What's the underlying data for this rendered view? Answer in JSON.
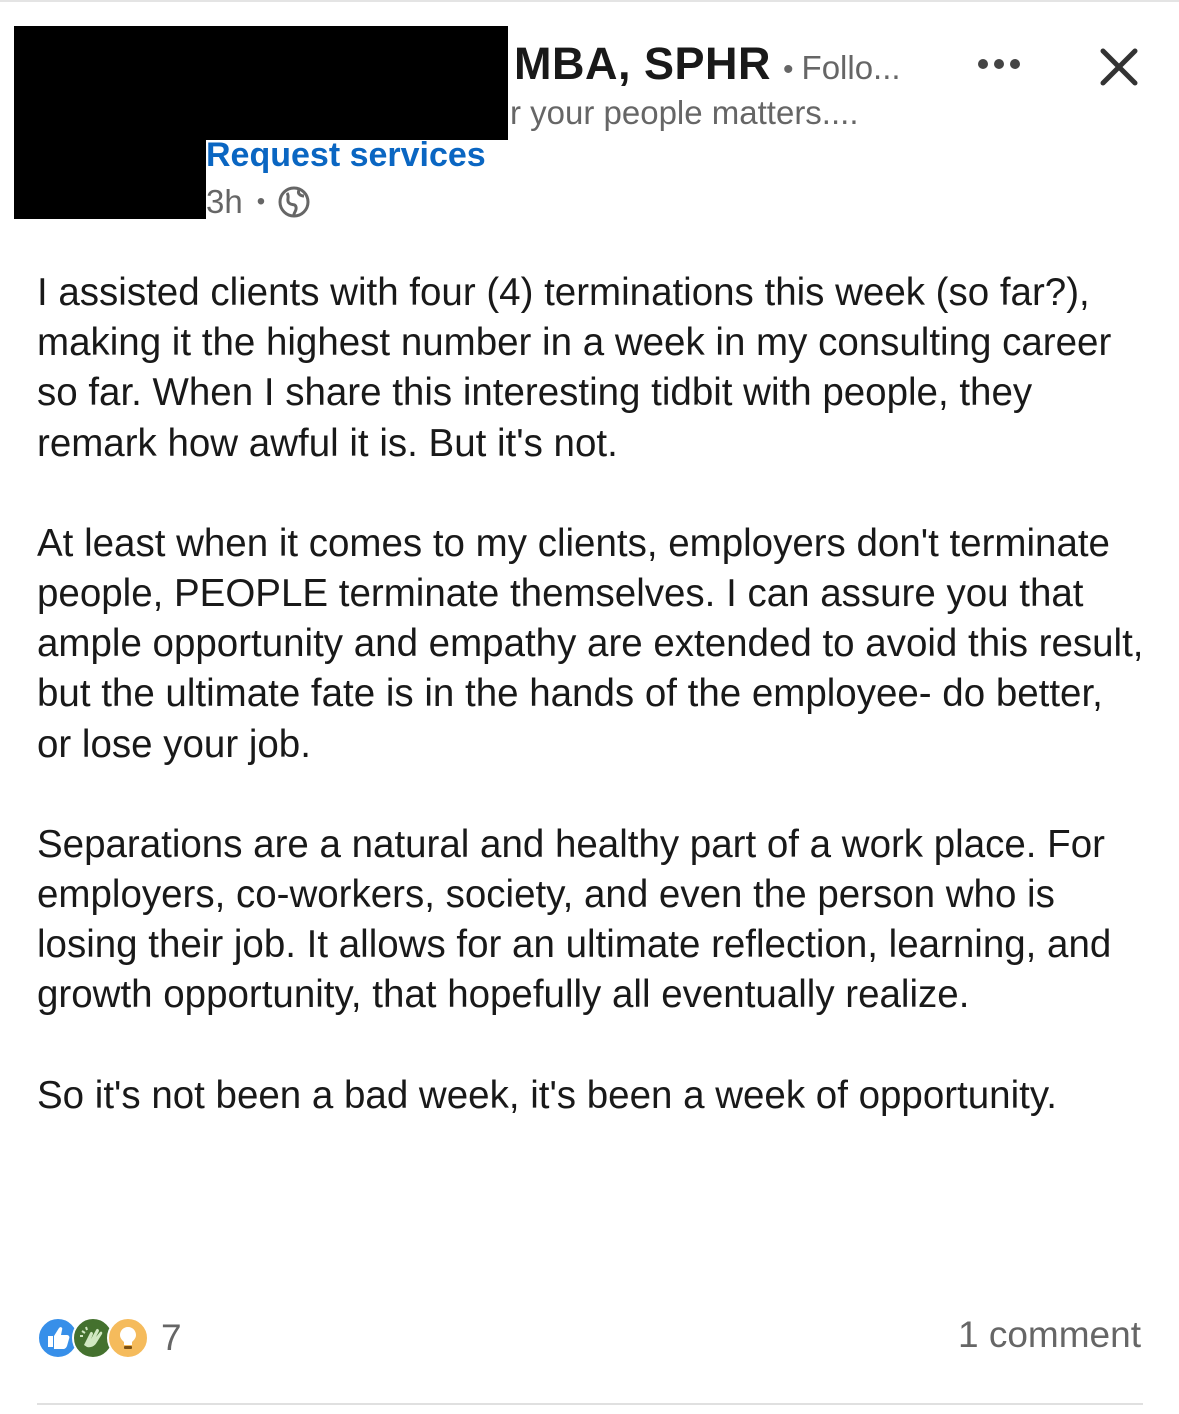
{
  "author": {
    "name_visible": "MBA, SPHR",
    "follow_label": "Follo...",
    "headline_visible": "r your people matters....",
    "request_services_label": "Request services",
    "timestamp": "3h",
    "visibility_icon": "globe-icon"
  },
  "header_actions": {
    "more_icon": "more-horizontal-icon",
    "close_icon": "close-icon"
  },
  "post": {
    "paragraphs": [
      "I assisted clients with four (4) terminations this week (so far?), making it the highest number in a week in my consulting career so far. When I share this interesting tidbit with people, they remark how awful it is. But it's not.",
      "At least when it comes to my clients, employers don't terminate people, PEOPLE terminate themselves. I can assure you that ample opportunity and empathy are extended to avoid this result, but the ultimate fate is in the hands of the employee- do better, or lose your job.",
      "Separations are a natural and healthy part of a work place. For employers, co-workers, society, and even the person who is losing their job. It allows for an ultimate reflection, learning, and growth opportunity, that hopefully all eventually realize.",
      "So it's not been a bad week, it's been a week of opportunity."
    ]
  },
  "social": {
    "reactions": [
      "like-icon",
      "celebrate-icon",
      "insightful-icon"
    ],
    "reaction_count": "7",
    "comment_count_label": "1 comment"
  },
  "colors": {
    "link": "#0a66c2",
    "muted_text": "#666666",
    "body_text": "#191919",
    "like": "#378fe9",
    "celebrate": "#44712e",
    "insightful": "#f5bb5c"
  }
}
